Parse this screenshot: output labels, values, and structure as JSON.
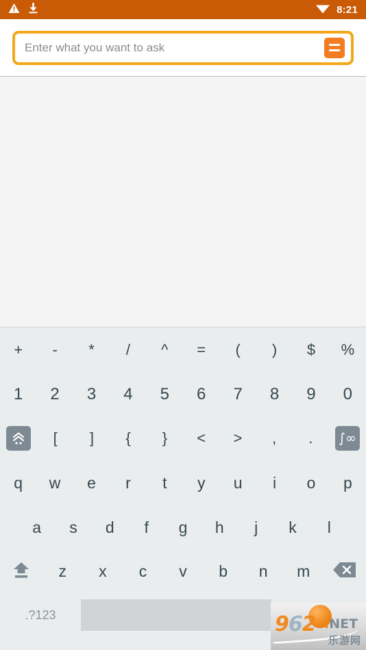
{
  "statusbar": {
    "time": "8:21",
    "icons": [
      "warning-triangle-icon",
      "download-icon",
      "wifi-icon"
    ]
  },
  "search": {
    "placeholder": "Enter what you want to ask",
    "value": "",
    "menu_button": "menu-equals-icon",
    "border_color": "#f3a81c",
    "button_color": "#f47b20"
  },
  "theme": {
    "statusbar_bg": "#c95a06",
    "content_bg": "#f4f4f4",
    "keyboard_bg": "#e9edee",
    "key_text": "#37474f",
    "modkey_bg": "#7d8a94",
    "spacebar_bg": "#d0d4d6"
  },
  "keyboard": {
    "rows": {
      "symbols": [
        "+",
        "-",
        "*",
        "/",
        "^",
        "=",
        "(",
        ")",
        "$",
        "%"
      ],
      "numbers": [
        "1",
        "2",
        "3",
        "4",
        "5",
        "6",
        "7",
        "8",
        "9",
        "0"
      ],
      "brackets": [
        "[",
        "]",
        "{",
        "}",
        "<",
        ">",
        ",",
        "."
      ],
      "qwerty": [
        "q",
        "w",
        "e",
        "r",
        "t",
        "y",
        "u",
        "i",
        "o",
        "p"
      ],
      "asdf": [
        "a",
        "s",
        "d",
        "f",
        "g",
        "h",
        "j",
        "k",
        "l"
      ],
      "zxcv": [
        "z",
        "x",
        "c",
        "v",
        "b",
        "n",
        "m"
      ]
    },
    "special": {
      "more_symbols": "chevron-double-up-icon",
      "math_panel": "∫∞",
      "shift": "shift-icon",
      "backspace": "backspace-icon",
      "symbols_toggle": ".?123",
      "spacebar": ""
    }
  },
  "watermark": {
    "digit_9": "9",
    "digit_6": "6",
    "digit_2": "2",
    "dot": ".",
    "net": "NET",
    "chinese": "乐游网"
  }
}
